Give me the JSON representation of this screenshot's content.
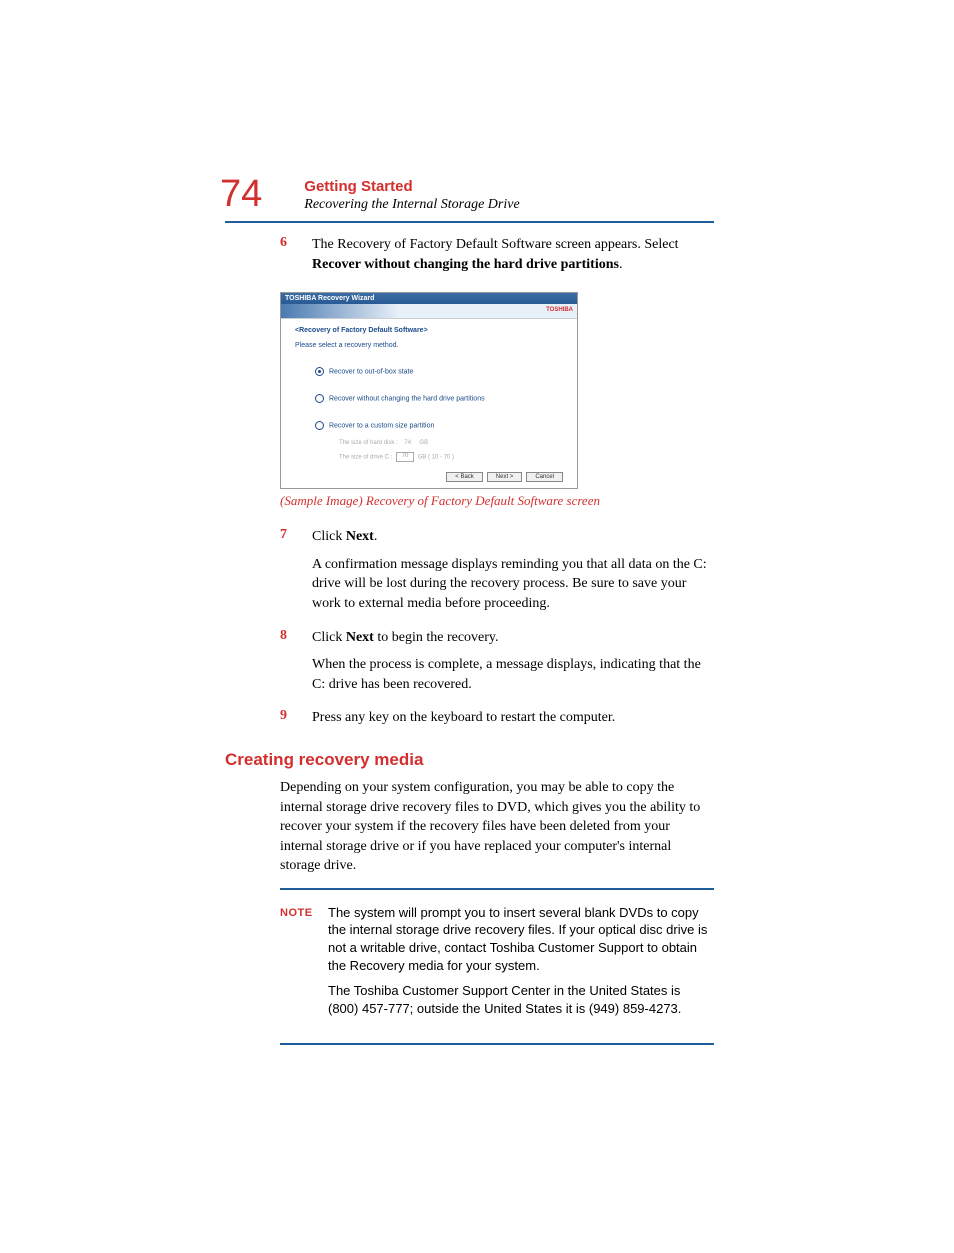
{
  "page_number": "74",
  "chapter": "Getting Started",
  "section_top": "Recovering the Internal Storage Drive",
  "steps": {
    "s6": {
      "num": "6",
      "text_a": "The Recovery of Factory Default Software screen appears. Select ",
      "text_b": "Recover without changing the hard drive partitions",
      "text_c": "."
    },
    "s7": {
      "num": "7",
      "text_a": "Click ",
      "text_b": "Next",
      "text_c": ".",
      "para2": "A confirmation message displays reminding you that all data on the C: drive will be lost during the recovery process. Be sure to save your work to external media before proceeding."
    },
    "s8": {
      "num": "8",
      "text_a": "Click ",
      "text_b": "Next",
      "text_c": " to begin the recovery.",
      "para2": "When the process is complete, a message displays, indicating that the C: drive has been recovered."
    },
    "s9": {
      "num": "9",
      "text": "Press any key on the keyboard to restart the computer."
    }
  },
  "screenshot": {
    "title": "TOSHIBA Recovery Wizard",
    "brand": "TOSHIBA",
    "heading": "<Recovery of Factory Default Software>",
    "sub": "Please select a recovery method.",
    "opt1": "Recover to out-of-box state",
    "opt2": "Recover without changing the hard drive partitions",
    "opt3": "Recover to a custom size partition",
    "disk_label": "The size of hard disk :",
    "disk_val": "74",
    "disk_unit": "GB",
    "drive_label": "The size of drive C :",
    "drive_val": "70",
    "drive_suffix": "GB  ( 10 - 70 )",
    "btn_back": "< Back",
    "btn_next": "Next >",
    "btn_cancel": "Cancel"
  },
  "caption": "(Sample Image) Recovery of Factory Default Software screen",
  "section_heading": "Creating recovery media",
  "section_body": "Depending on your system configuration, you may be able to copy the internal storage drive recovery files to DVD, which gives you the ability to recover your system if the recovery files have been deleted from your internal storage drive or if you have replaced your computer's internal storage drive.",
  "note": {
    "label": "NOTE",
    "p1": "The system will prompt you to insert several blank DVDs to copy the internal storage drive recovery files. If your optical disc drive is not a writable drive, contact Toshiba Customer Support to obtain the Recovery media for your system.",
    "p2": "The Toshiba Customer Support Center in the United States is (800) 457-777; outside the United States it is (949) 859-4273."
  }
}
